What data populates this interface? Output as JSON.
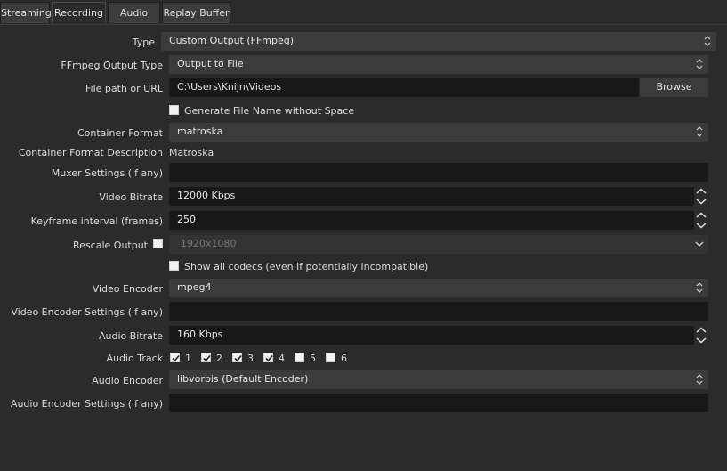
{
  "tabs": [
    "Streaming",
    "Recording",
    "Audio",
    "Replay Buffer"
  ],
  "labels": {
    "type": "Type",
    "ffmpeg_output_type": "FFmpeg Output Type",
    "file_path": "File path or URL",
    "container_format": "Container Format",
    "container_format_description": "Container Format Description",
    "muxer_settings": "Muxer Settings (if any)",
    "video_bitrate": "Video Bitrate",
    "keyframe_interval": "Keyframe interval (frames)",
    "rescale_output": "Rescale Output",
    "video_encoder": "Video Encoder",
    "video_encoder_settings": "Video Encoder Settings (if any)",
    "audio_bitrate": "Audio Bitrate",
    "audio_track": "Audio Track",
    "audio_encoder": "Audio Encoder",
    "audio_encoder_settings": "Audio Encoder Settings (if any)"
  },
  "values": {
    "type": "Custom Output (FFmpeg)",
    "ffmpeg_output_type": "Output to File",
    "file_path": "C:\\Users\\Knijn\\Videos",
    "container_format": "matroska",
    "container_format_description": "Matroska",
    "muxer_settings": "",
    "video_bitrate": "12000 Kbps",
    "keyframe_interval": "250",
    "rescale_output": "1920x1080",
    "video_encoder": "mpeg4",
    "video_encoder_settings": "",
    "audio_bitrate": "160 Kbps",
    "audio_encoder": "libvorbis (Default Encoder)",
    "audio_encoder_settings": ""
  },
  "checkboxes": {
    "generate_file_name_without_space": {
      "label": "Generate File Name without Space",
      "checked": false
    },
    "rescale_output": {
      "checked": false
    },
    "show_all_codecs": {
      "label": "Show all codecs (even if potentially incompatible)",
      "checked": false
    }
  },
  "buttons": {
    "browse": "Browse"
  },
  "audio_tracks": [
    {
      "label": "1",
      "checked": true
    },
    {
      "label": "2",
      "checked": true
    },
    {
      "label": "3",
      "checked": true
    },
    {
      "label": "4",
      "checked": true
    },
    {
      "label": "5",
      "checked": false
    },
    {
      "label": "6",
      "checked": false
    }
  ],
  "colors": {
    "background": "#2b2b2b",
    "field": "#181818",
    "combo": "#3b3b3b",
    "text": "#dcdcdc"
  },
  "icons": [
    "updown-arrows-icon",
    "chevron-down-icon",
    "spin-up-icon",
    "spin-down-icon",
    "checkmark-icon"
  ]
}
